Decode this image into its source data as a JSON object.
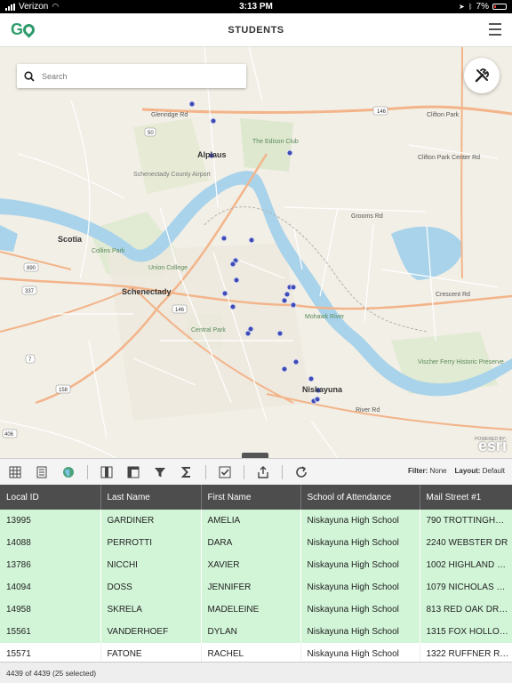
{
  "status_bar": {
    "carrier": "Verizon",
    "time": "3:13 PM",
    "battery": "7%"
  },
  "header": {
    "logo": "GO",
    "title": "STUDENTS"
  },
  "search": {
    "placeholder": "Search"
  },
  "map": {
    "labels": {
      "alplaus": "Alplaus",
      "edison_club": "The Edison Club",
      "schenectady_airport": "Schenectady County Airport",
      "scotia": "Scotia",
      "collins_park": "Collins Park",
      "union_college": "Union College",
      "schenectady": "Schenectady",
      "central_park": "Central Park",
      "mohawk_river": "Mohawk River",
      "niskayuna": "Niskayuna",
      "vischer_ferry": "Vischer Ferry Historic Preserve",
      "grooms_rd": "Grooms Rd",
      "clifton_park_center": "Clifton Park Center Rd",
      "crescent_rd": "Crescent Rd",
      "glenridge_rd": "Glenridge Rd",
      "clifton_park": "Clifton Park",
      "river_rd": "River Rd",
      "hwy_146": "146",
      "hwy_50": "50",
      "hwy_890": "890",
      "hwy_337": "337",
      "hwy_7": "7",
      "hwy_158": "158",
      "hwy_406": "406"
    },
    "powered_by": "POWERED BY",
    "esri": "esri"
  },
  "toolbar": {
    "filter_label": "Filter:",
    "filter_value": "None",
    "layout_label": "Layout:",
    "layout_value": "Default"
  },
  "grid": {
    "columns": [
      "Local ID",
      "Last Name",
      "First Name",
      "School of Attendance",
      "Mail Street #1"
    ],
    "rows": [
      {
        "selected": true,
        "cells": [
          "13995",
          "GARDINER",
          "AMELIA",
          "Niskayuna High School",
          "790 TROTTINGH…"
        ]
      },
      {
        "selected": true,
        "cells": [
          "14088",
          "PERROTTI",
          "DARA",
          "Niskayuna High School",
          "2240 WEBSTER DR"
        ]
      },
      {
        "selected": true,
        "cells": [
          "13786",
          "NICCHI",
          "XAVIER",
          "Niskayuna High School",
          "1002 HIGHLAND …"
        ]
      },
      {
        "selected": true,
        "cells": [
          "14094",
          "DOSS",
          "JENNIFER",
          "Niskayuna High School",
          "1079 NICHOLAS …"
        ]
      },
      {
        "selected": true,
        "cells": [
          "14958",
          "SKRELA",
          "MADELEINE",
          "Niskayuna High School",
          "813 RED OAK DR…"
        ]
      },
      {
        "selected": true,
        "cells": [
          "15561",
          "VANDERHOEF",
          "DYLAN",
          "Niskayuna High School",
          "1315 FOX HOLLO…"
        ]
      },
      {
        "selected": false,
        "cells": [
          "15571",
          "FATONE",
          "RACHEL",
          "Niskayuna High School",
          "1322 RUFFNER R…"
        ]
      }
    ]
  },
  "footer": {
    "summary": "4439 of 4439 (25 selected)"
  }
}
